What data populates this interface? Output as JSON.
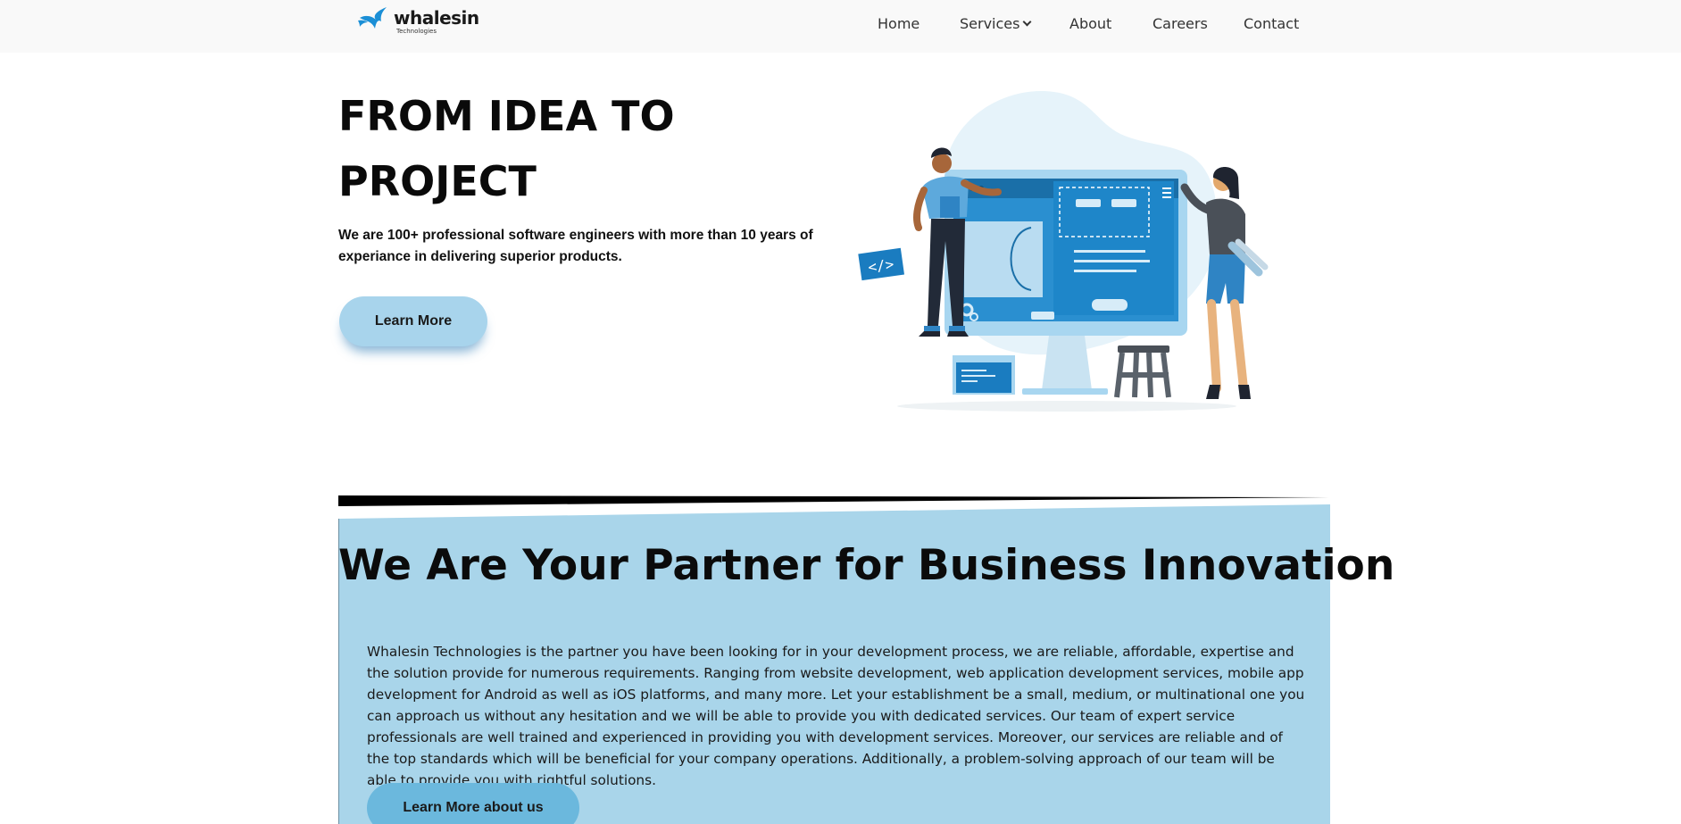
{
  "brand": {
    "name": "whalesin",
    "tagline": "Technologies",
    "accent": "#1b8fd6"
  },
  "nav": {
    "items": [
      {
        "label": "Home"
      },
      {
        "label": "Services",
        "has_dropdown": true
      },
      {
        "label": "About"
      },
      {
        "label": "Careers"
      },
      {
        "label": "Contact"
      }
    ]
  },
  "hero": {
    "title_line1": "FROM IDEA TO",
    "title_line2": "PROJECT",
    "subtitle": "We are 100+ professional software engineers with more than 10 years of experiance in delivering superior products.",
    "cta_label": "Learn More",
    "illustration": "developer-and-designer-at-monitor-illustration"
  },
  "partner": {
    "title": "We Are Your Partner for Business Innovation",
    "body": "Whalesin Technologies is the partner you have been looking for in your development process, we are reliable, affordable, expertise and the solution provide for numerous requirements. Ranging from website development, web application development services, mobile app development for Android as well as iOS platforms, and many more. Let your establishment be a small, medium, or multinational one you can approach us without any hesitation and we will be able to provide you with dedicated services. Our team of expert service professionals are well trained and experienced in providing you with development services. Moreover, our services are reliable and of the top standards which will be beneficial for your company operations. Additionally, a problem-solving approach of our team will be able to provide you with rightful solutions.",
    "cta_label": "Learn More about us"
  },
  "colors": {
    "nav_bg": "#f9f9f9",
    "button_light": "#a8d4ec",
    "section_bg": "#a9d5ea",
    "button_dark": "#6bb8dd"
  }
}
